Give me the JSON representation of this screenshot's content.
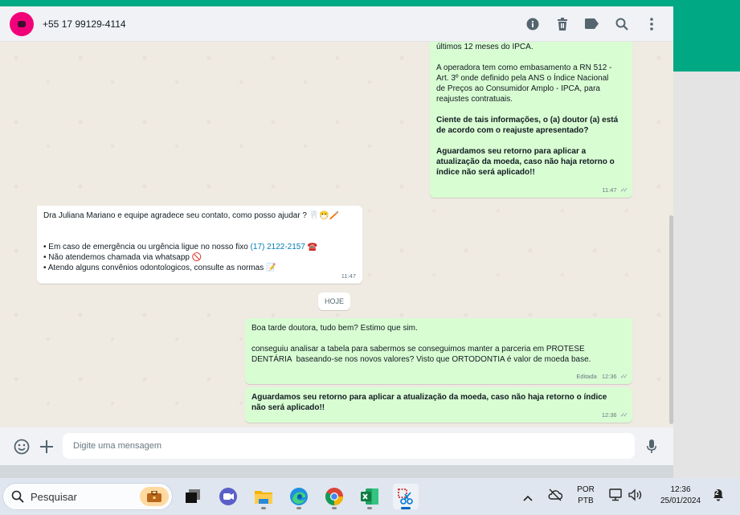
{
  "header": {
    "contact_name": "+55 17 99129-4114",
    "icons": [
      "info-icon",
      "trash-icon",
      "label-icon",
      "search-icon",
      "menu-icon"
    ]
  },
  "messages": {
    "m1": {
      "p1": "últimos 12 meses do IPCA.",
      "p2": "A operadora tem como embasamento a RN 512 -\nArt. 3º onde definido pela ANS o Índice Nacional\nde Preços ao Consumidor Amplo - IPCA, para\nreajustes contratuais.",
      "p3": "Ciente de tais informações, o (a) doutor (a) está\nde acordo com o reajuste apresentado?",
      "p4": "Aguardamos seu retorno para aplicar a\natualização da moeda, caso não haja retorno o\níndice não será aplicado!!",
      "time": "11:47"
    },
    "m2": {
      "line1": "Dra Juliana Mariano e equipe agradece seu contato, como posso ajudar ? 🦷😷🪥",
      "line2_prefix": "• Em caso de emergência ou urgência ligue no nosso fixo ",
      "line2_phone": "(17) 2122-2157",
      "line2_suffix": " ☎️",
      "line3": "• Não atendemos chamada via whatsapp 🚫",
      "line4": "• Atendo alguns convênios odontologicos, consulte as normas 📝",
      "time": "11:47"
    },
    "date_chip": "HOJE",
    "m3": {
      "p1": "Boa tarde doutora, tudo bem? Estimo que sim.",
      "p2": "conseguiu analisar a tabela para sabermos se conseguimos manter a parceria em PROTESE\nDENTÁRIA  baseando-se nos novos valores? Visto que ORTODONTIA é valor de moeda base.",
      "edited": "Editada",
      "time": "12:36"
    },
    "m4": {
      "p1": "Aguardamos seu retorno para aplicar a atualização da moeda, caso não haja retorno o índice\nnão será aplicado!!",
      "time": "12:36"
    }
  },
  "composer": {
    "placeholder": "Digite uma mensagem"
  },
  "taskbar": {
    "search_label": "Pesquisar",
    "language": "POR",
    "layout": "PTB",
    "clock_time": "12:36",
    "clock_date": "25/01/2024",
    "notification_count": "2"
  },
  "colors": {
    "accent": "#00a884",
    "outgoing_bubble": "#d9fdd3",
    "incoming_bubble": "#ffffff",
    "chat_bg": "#efeae2"
  }
}
